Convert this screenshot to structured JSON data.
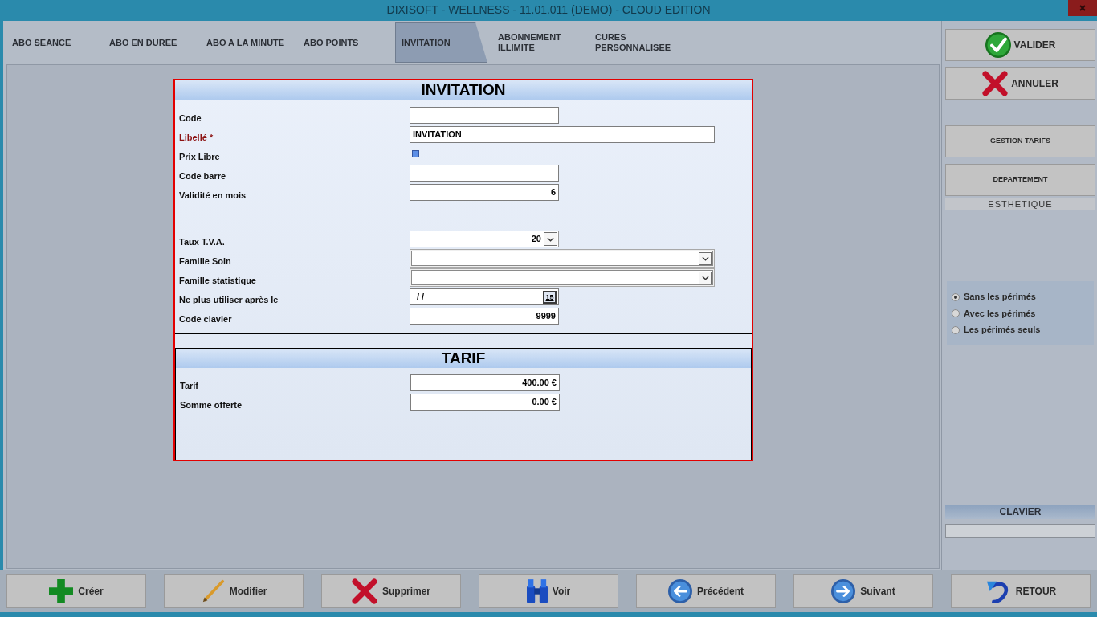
{
  "window": {
    "title": "DIXISOFT - WELLNESS - 11.01.011 (DEMO) - CLOUD EDITION"
  },
  "tabs": [
    {
      "label": "ABO SEANCE",
      "selected": false
    },
    {
      "label": "ABO EN DUREE",
      "selected": false
    },
    {
      "label": "ABO A LA MINUTE",
      "selected": false
    },
    {
      "label": "ABO POINTS",
      "selected": false
    },
    {
      "label": "INVITATION",
      "selected": true
    },
    {
      "label": "ABONNEMENT ILLIMITE",
      "selected": false
    },
    {
      "label": "CURES PERSONNALISEE",
      "selected": false
    }
  ],
  "dialog": {
    "sections": [
      {
        "title": "INVITATION",
        "groups": [
          {
            "fields": [
              {
                "label": "Code",
                "kind": "text",
                "required": false
              },
              {
                "label": "Libellé *",
                "kind": "longtext",
                "required": true,
                "value": "INVITATION"
              },
              {
                "label": "Prix Libre",
                "kind": "checkbox",
                "required": false,
                "checked": false
              },
              {
                "label": "Code barre",
                "kind": "text",
                "required": false
              },
              {
                "label": "Validité en mois",
                "kind": "number",
                "required": false,
                "value": "6"
              }
            ]
          },
          {
            "fields": [
              {
                "label": "Taux T.V.A.",
                "kind": "dropdown",
                "required": false,
                "value": "20"
              },
              {
                "label": "Famille Soin",
                "kind": "combo",
                "required": false
              },
              {
                "label": "Famille statistique",
                "kind": "combo",
                "required": false
              },
              {
                "label": "Ne plus utiliser après le",
                "kind": "date",
                "required": false,
                "value": "/ /",
                "picker": "15"
              },
              {
                "label": "Code clavier",
                "kind": "number",
                "required": false,
                "value": "9999"
              }
            ]
          }
        ]
      },
      {
        "title": "TARIF",
        "groups": [
          {
            "fields": [
              {
                "label": "Tarif",
                "kind": "number",
                "required": false,
                "value": "400.00 €"
              },
              {
                "label": "Somme offerte",
                "kind": "number",
                "required": false,
                "value": "0.00 €"
              }
            ]
          }
        ]
      }
    ]
  },
  "side_panel": {
    "actions": [
      {
        "label": "VALIDER"
      },
      {
        "label": "ANNULER"
      }
    ],
    "options": [
      {
        "label": "GESTION TARIFS"
      },
      {
        "label": "DEPARTEMENT"
      }
    ],
    "department": "ESTHETIQUE",
    "filter": [
      {
        "label": "Sans les périmés",
        "selected": true
      },
      {
        "label": "Avec les périmés",
        "selected": false
      },
      {
        "label": "Les périmés seuls",
        "selected": false
      }
    ],
    "keyboard": {
      "title": "CLAVIER"
    }
  },
  "toolbar": [
    {
      "label": "Créer"
    },
    {
      "label": "Modifier"
    },
    {
      "label": "Supprimer"
    },
    {
      "label": "Voir"
    },
    {
      "label": "Précédent"
    },
    {
      "label": "Suivant"
    },
    {
      "label": "RETOUR"
    }
  ]
}
